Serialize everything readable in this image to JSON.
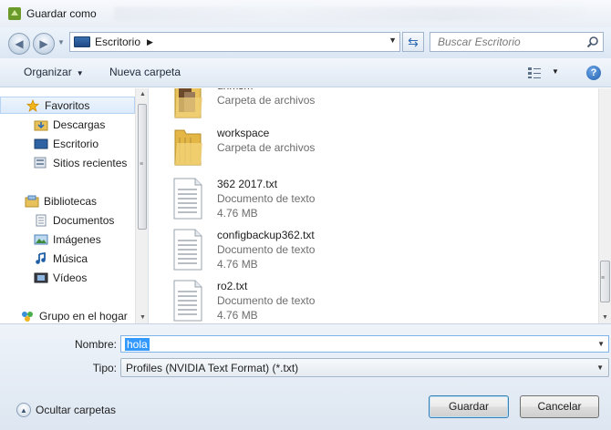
{
  "window": {
    "title": "Guardar como"
  },
  "address": {
    "location": "Escritorio",
    "search_placeholder": "Buscar Escritorio"
  },
  "toolbar": {
    "organize_label": "Organizar",
    "new_folder_label": "Nueva carpeta"
  },
  "sidebar": {
    "items": [
      {
        "label": "Favoritos",
        "icon": "star-icon"
      },
      {
        "label": "Descargas",
        "icon": "downloads-folder-icon"
      },
      {
        "label": "Escritorio",
        "icon": "desktop-icon"
      },
      {
        "label": "Sitios recientes",
        "icon": "recent-places-icon"
      },
      {
        "label": "Bibliotecas",
        "icon": "libraries-icon"
      },
      {
        "label": "Documentos",
        "icon": "documents-icon"
      },
      {
        "label": "Imágenes",
        "icon": "pictures-icon"
      },
      {
        "label": "Música",
        "icon": "music-icon"
      },
      {
        "label": "Vídeos",
        "icon": "videos-icon"
      },
      {
        "label": "Grupo en el hogar",
        "icon": "homegroup-icon"
      }
    ]
  },
  "files": [
    {
      "name": "unmsm",
      "type": "Carpeta de archivos",
      "size": "",
      "kind": "folder"
    },
    {
      "name": "workspace",
      "type": "Carpeta de archivos",
      "size": "",
      "kind": "folder"
    },
    {
      "name": "362 2017.txt",
      "type": "Documento de texto",
      "size": "4.76 MB",
      "kind": "text"
    },
    {
      "name": "configbackup362.txt",
      "type": "Documento de texto",
      "size": "4.76 MB",
      "kind": "text"
    },
    {
      "name": "ro2.txt",
      "type": "Documento de texto",
      "size": "4.76 MB",
      "kind": "text"
    }
  ],
  "form": {
    "filename_label": "Nombre:",
    "filename_value": "hola",
    "type_label": "Tipo:",
    "type_value": "Profiles (NVIDIA Text Format) (*.txt)",
    "hide_folders_label": "Ocultar carpetas",
    "save_label": "Guardar",
    "cancel_label": "Cancelar"
  },
  "colors": {
    "selection": "#3399ff",
    "accent": "#3c7fb1",
    "folder": "#e8c15a"
  }
}
